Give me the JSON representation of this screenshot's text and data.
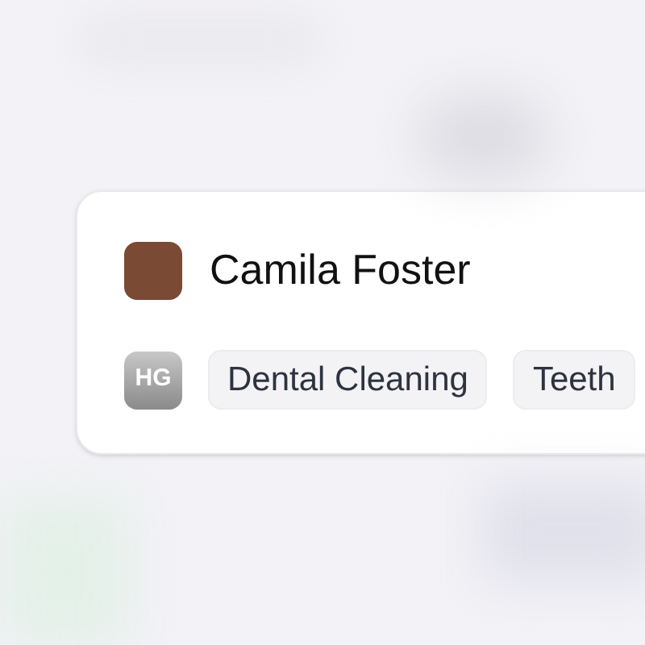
{
  "card": {
    "name": "Camila Foster",
    "badge": "HG",
    "tags": [
      "Dental Cleaning",
      "Teeth"
    ]
  }
}
